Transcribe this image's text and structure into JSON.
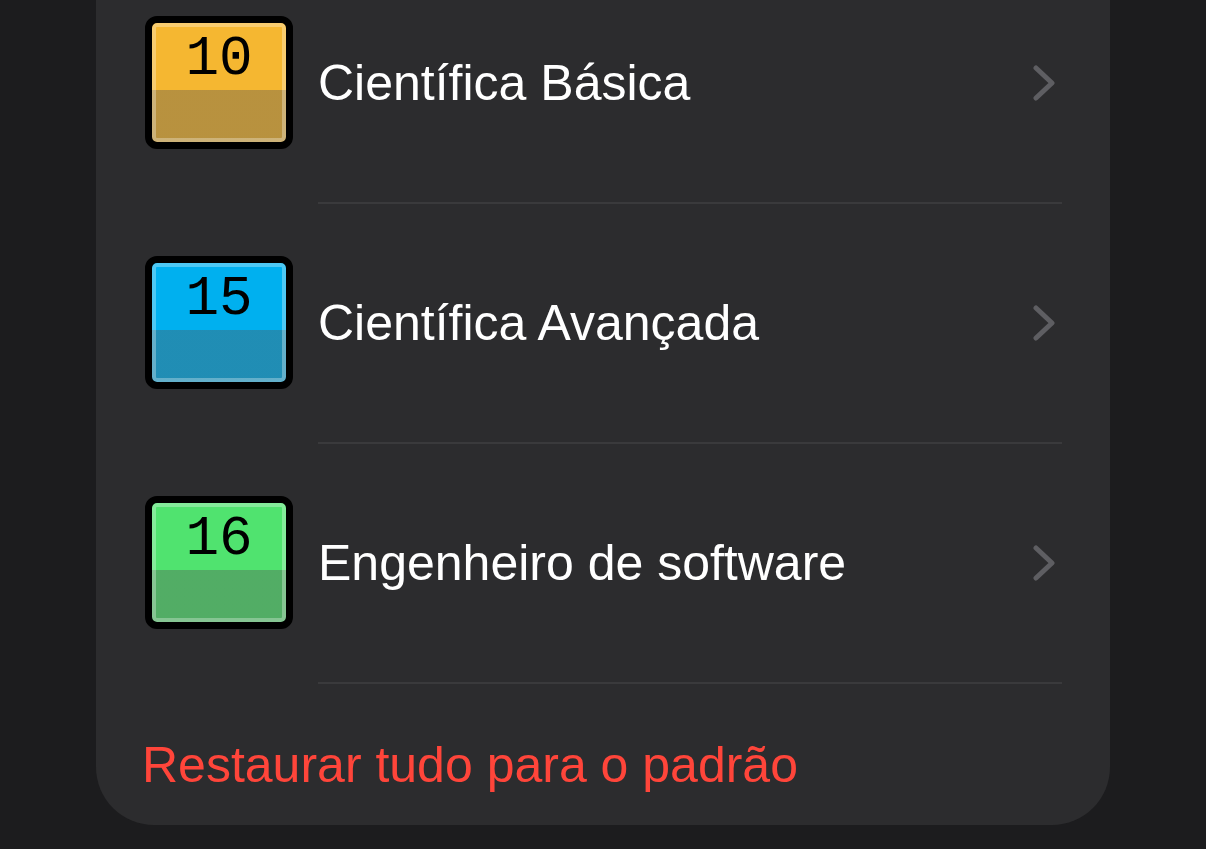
{
  "items": [
    {
      "badge": "10",
      "label": "Científica Básica",
      "color": "#f5b731"
    },
    {
      "badge": "15",
      "label": "Científica Avançada",
      "color": "#00b0ef"
    },
    {
      "badge": "16",
      "label": "Engenheiro de software",
      "color": "#50e36f"
    }
  ],
  "restore_button": "Restaurar tudo para o padrão"
}
